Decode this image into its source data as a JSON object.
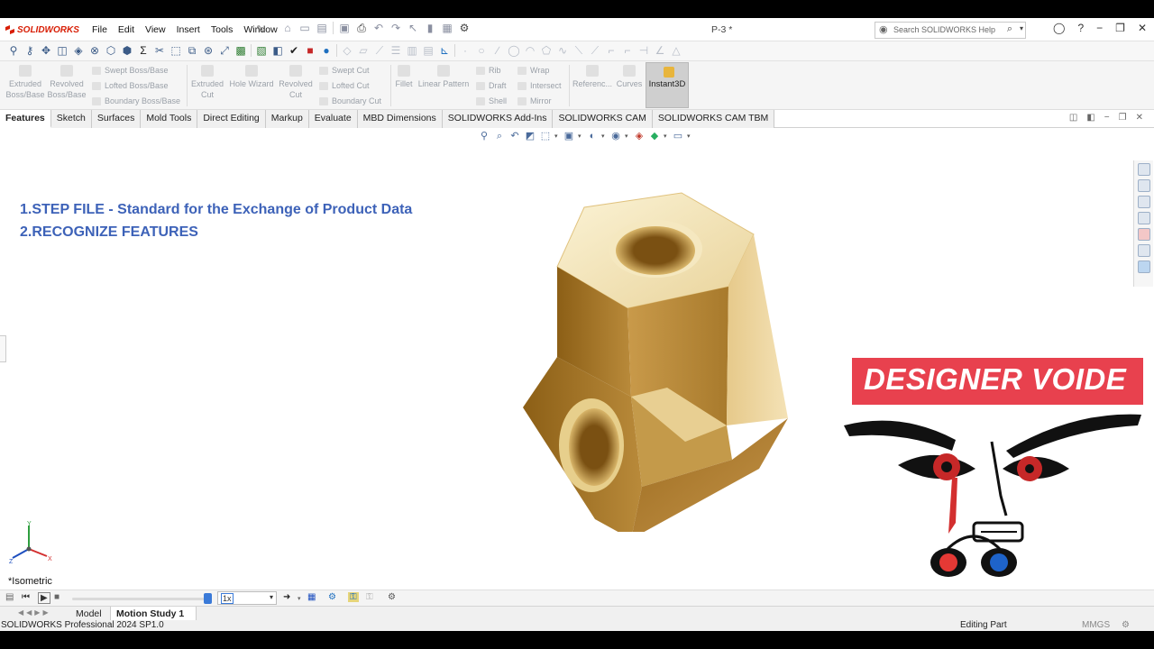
{
  "titlebar": {
    "app_name": "SOLIDWORKS",
    "menus": [
      "File",
      "Edit",
      "View",
      "Insert",
      "Tools",
      "Window"
    ],
    "document_title": "P-3 *",
    "search_placeholder": "Search SOLIDWORKS Help"
  },
  "ribbon": {
    "extruded_boss": "Extruded Boss/Base",
    "revolved_boss": "Revolved Boss/Base",
    "swept_boss": "Swept Boss/Base",
    "lofted_boss": "Lofted Boss/Base",
    "boundary_boss": "Boundary Boss/Base",
    "extruded_cut": "Extruded Cut",
    "hole_wizard": "Hole Wizard",
    "revolved_cut": "Revolved Cut",
    "swept_cut": "Swept Cut",
    "lofted_cut": "Lofted Cut",
    "boundary_cut": "Boundary Cut",
    "fillet": "Fillet",
    "linear_pattern": "Linear Pattern",
    "rib": "Rib",
    "draft": "Draft",
    "shell": "Shell",
    "wrap": "Wrap",
    "intersect": "Intersect",
    "mirror": "Mirror",
    "reference": "Referenc...",
    "curves": "Curves",
    "instant3d": "Instant3D"
  },
  "tabs": [
    "Features",
    "Sketch",
    "Surfaces",
    "Mold Tools",
    "Direct Editing",
    "Markup",
    "Evaluate",
    "MBD Dimensions",
    "SOLIDWORKS Add-Ins",
    "SOLIDWORKS CAM",
    "SOLIDWORKS CAM TBM"
  ],
  "overlay": {
    "line1": "1.STEP FILE - Standard for the Exchange of Product Data",
    "line2": "2.RECOGNIZE FEATURES"
  },
  "view": {
    "orientation": "*Isometric",
    "triad_y": "Y",
    "triad_x": "X",
    "triad_z": "Z"
  },
  "branding": {
    "name": "DESIGNER VOIDE"
  },
  "motion": {
    "speed": "1x"
  },
  "bottom_tabs": {
    "model": "Model",
    "motion_study": "Motion Study 1"
  },
  "status": {
    "version": "SOLIDWORKS Professional 2024 SP1.0",
    "mode": "Editing Part",
    "units": "MMGS"
  },
  "colors": {
    "overlay_text": "#3d62b8",
    "brand_bar": "#e8414e",
    "part_gold": "#c49a4a"
  }
}
